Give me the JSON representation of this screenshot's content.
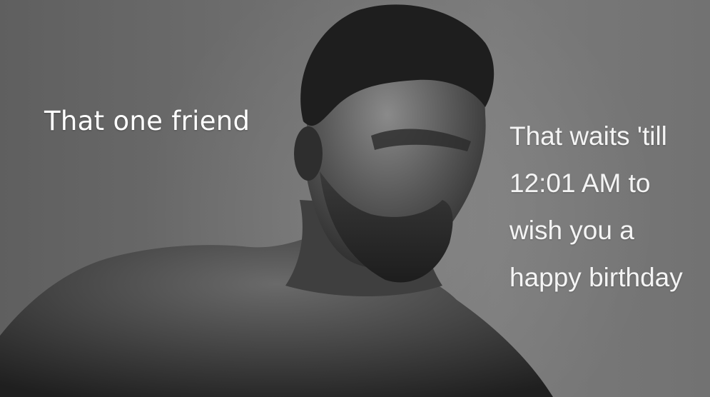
{
  "captions": {
    "left": "That one friend",
    "right_lines": [
      "That waits 'till",
      "12:01 AM to",
      "wish you a",
      "happy birthday"
    ]
  },
  "colors": {
    "background": "#6f6f6f",
    "caption_text": "#ffffff"
  }
}
